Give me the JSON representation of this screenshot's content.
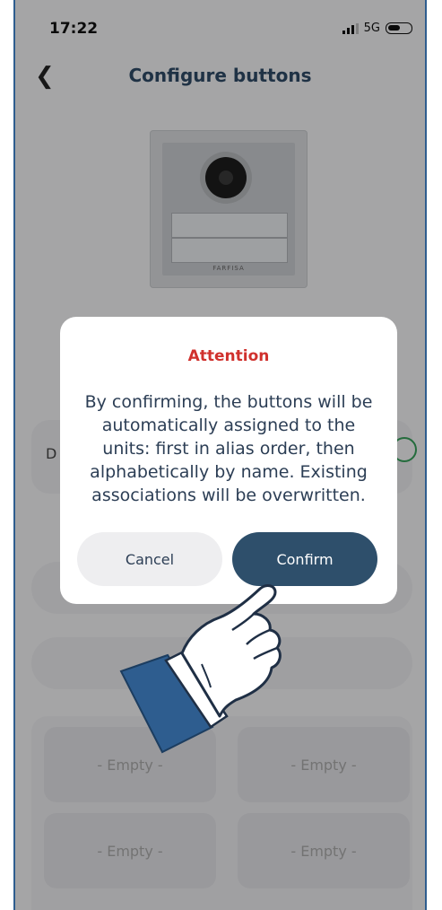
{
  "status": {
    "time": "17:22",
    "network": "5G"
  },
  "header": {
    "title": "Configure buttons"
  },
  "device": {
    "brand": "FARFISA"
  },
  "background": {
    "row_letter": "D",
    "slots": [
      "- Empty -",
      "- Empty -",
      "- Empty -",
      "- Empty -"
    ],
    "hidden_fragment": "t"
  },
  "dialog": {
    "title": "Attention",
    "message": "By confirming, the buttons will be automatically assigned to the units: first in alias order, then alphabetically by name. Existing associations will be overwritten.",
    "cancel_label": "Cancel",
    "confirm_label": "Confirm"
  },
  "colors": {
    "accent": "#2e4f6b",
    "title_red": "#d0312d",
    "toggle_green": "#36a05a"
  }
}
